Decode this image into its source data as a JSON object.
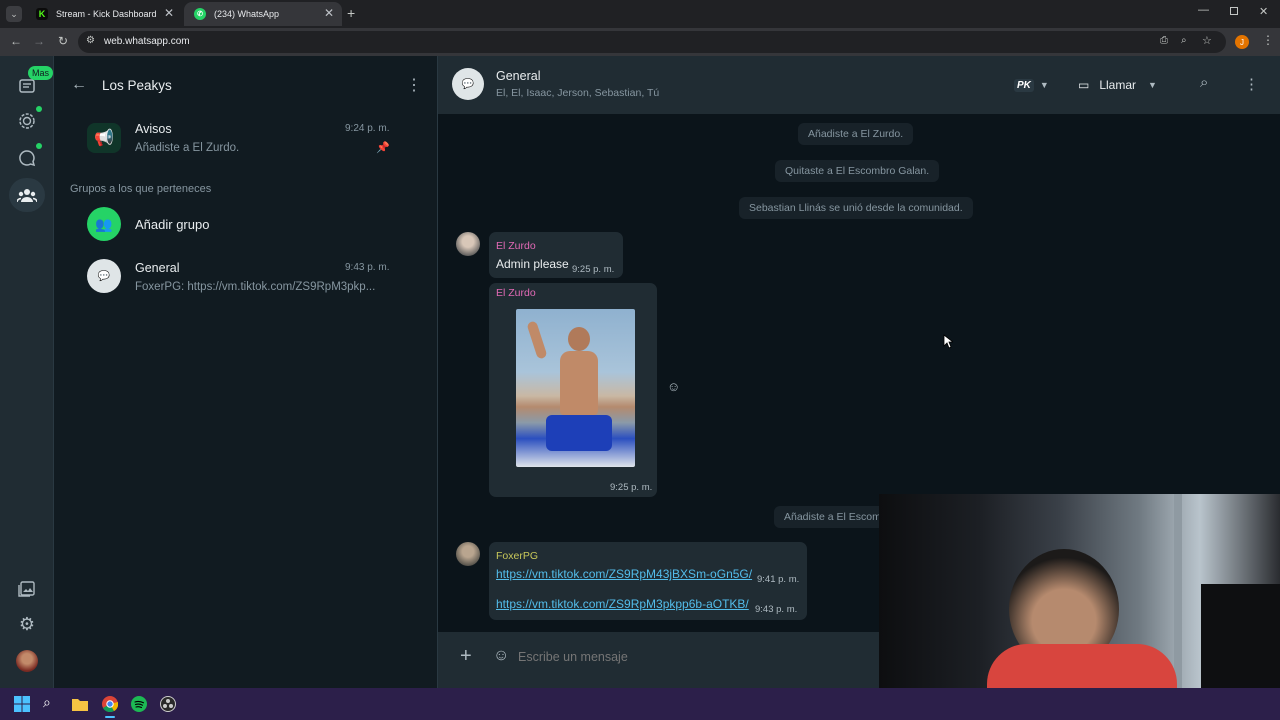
{
  "browser": {
    "tabs": [
      {
        "title": "Stream - Kick Dashboard",
        "active": false
      },
      {
        "title": "(234) WhatsApp",
        "active": true
      }
    ],
    "url": "web.whatsapp.com",
    "profile_initial": "J"
  },
  "rail": {
    "badge": "Mas"
  },
  "sidebar": {
    "title": "Los Peakys",
    "announcements": {
      "name": "Avisos",
      "time": "9:24 p. m.",
      "preview": "Añadiste a El Zurdo."
    },
    "section_label": "Grupos a los que perteneces",
    "add_group": "Añadir grupo",
    "general": {
      "name": "General",
      "time": "9:43 p. m.",
      "preview": "FoxerPG: https://vm.tiktok.com/ZS9RpM3pkp..."
    }
  },
  "chat": {
    "name": "General",
    "members": "El, El, Isaac, Jerson, Sebastian, Tú",
    "call_label": "Llamar",
    "pk_label": "PK",
    "system_messages": [
      "Añadiste a El Zurdo.",
      "Quitaste a El Escombro Galan.",
      "Sebastian Llinás se unió desde la comunidad.",
      "Añadiste a El Escom"
    ],
    "msg1": {
      "sender": "El Zurdo",
      "text": "Admin please",
      "time": "9:25 p. m."
    },
    "msg2": {
      "sender": "El Zurdo",
      "time": "9:25 p. m."
    },
    "msg3": {
      "sender": "FoxerPG",
      "link1": "https://vm.tiktok.com/ZS9RpM43jBXSm-oGn5G/",
      "time1": "9:41 p. m.",
      "link2": "https://vm.tiktok.com/ZS9RpM3pkpp6b-aOTKB/",
      "time2": "9:43 p. m."
    },
    "composer_placeholder": "Escribe un mensaje"
  },
  "colors": {
    "accent_green": "#25d366",
    "sender_pink": "#e26ab6",
    "sender_yellow": "#c8c85a",
    "link_blue": "#53bdeb"
  }
}
